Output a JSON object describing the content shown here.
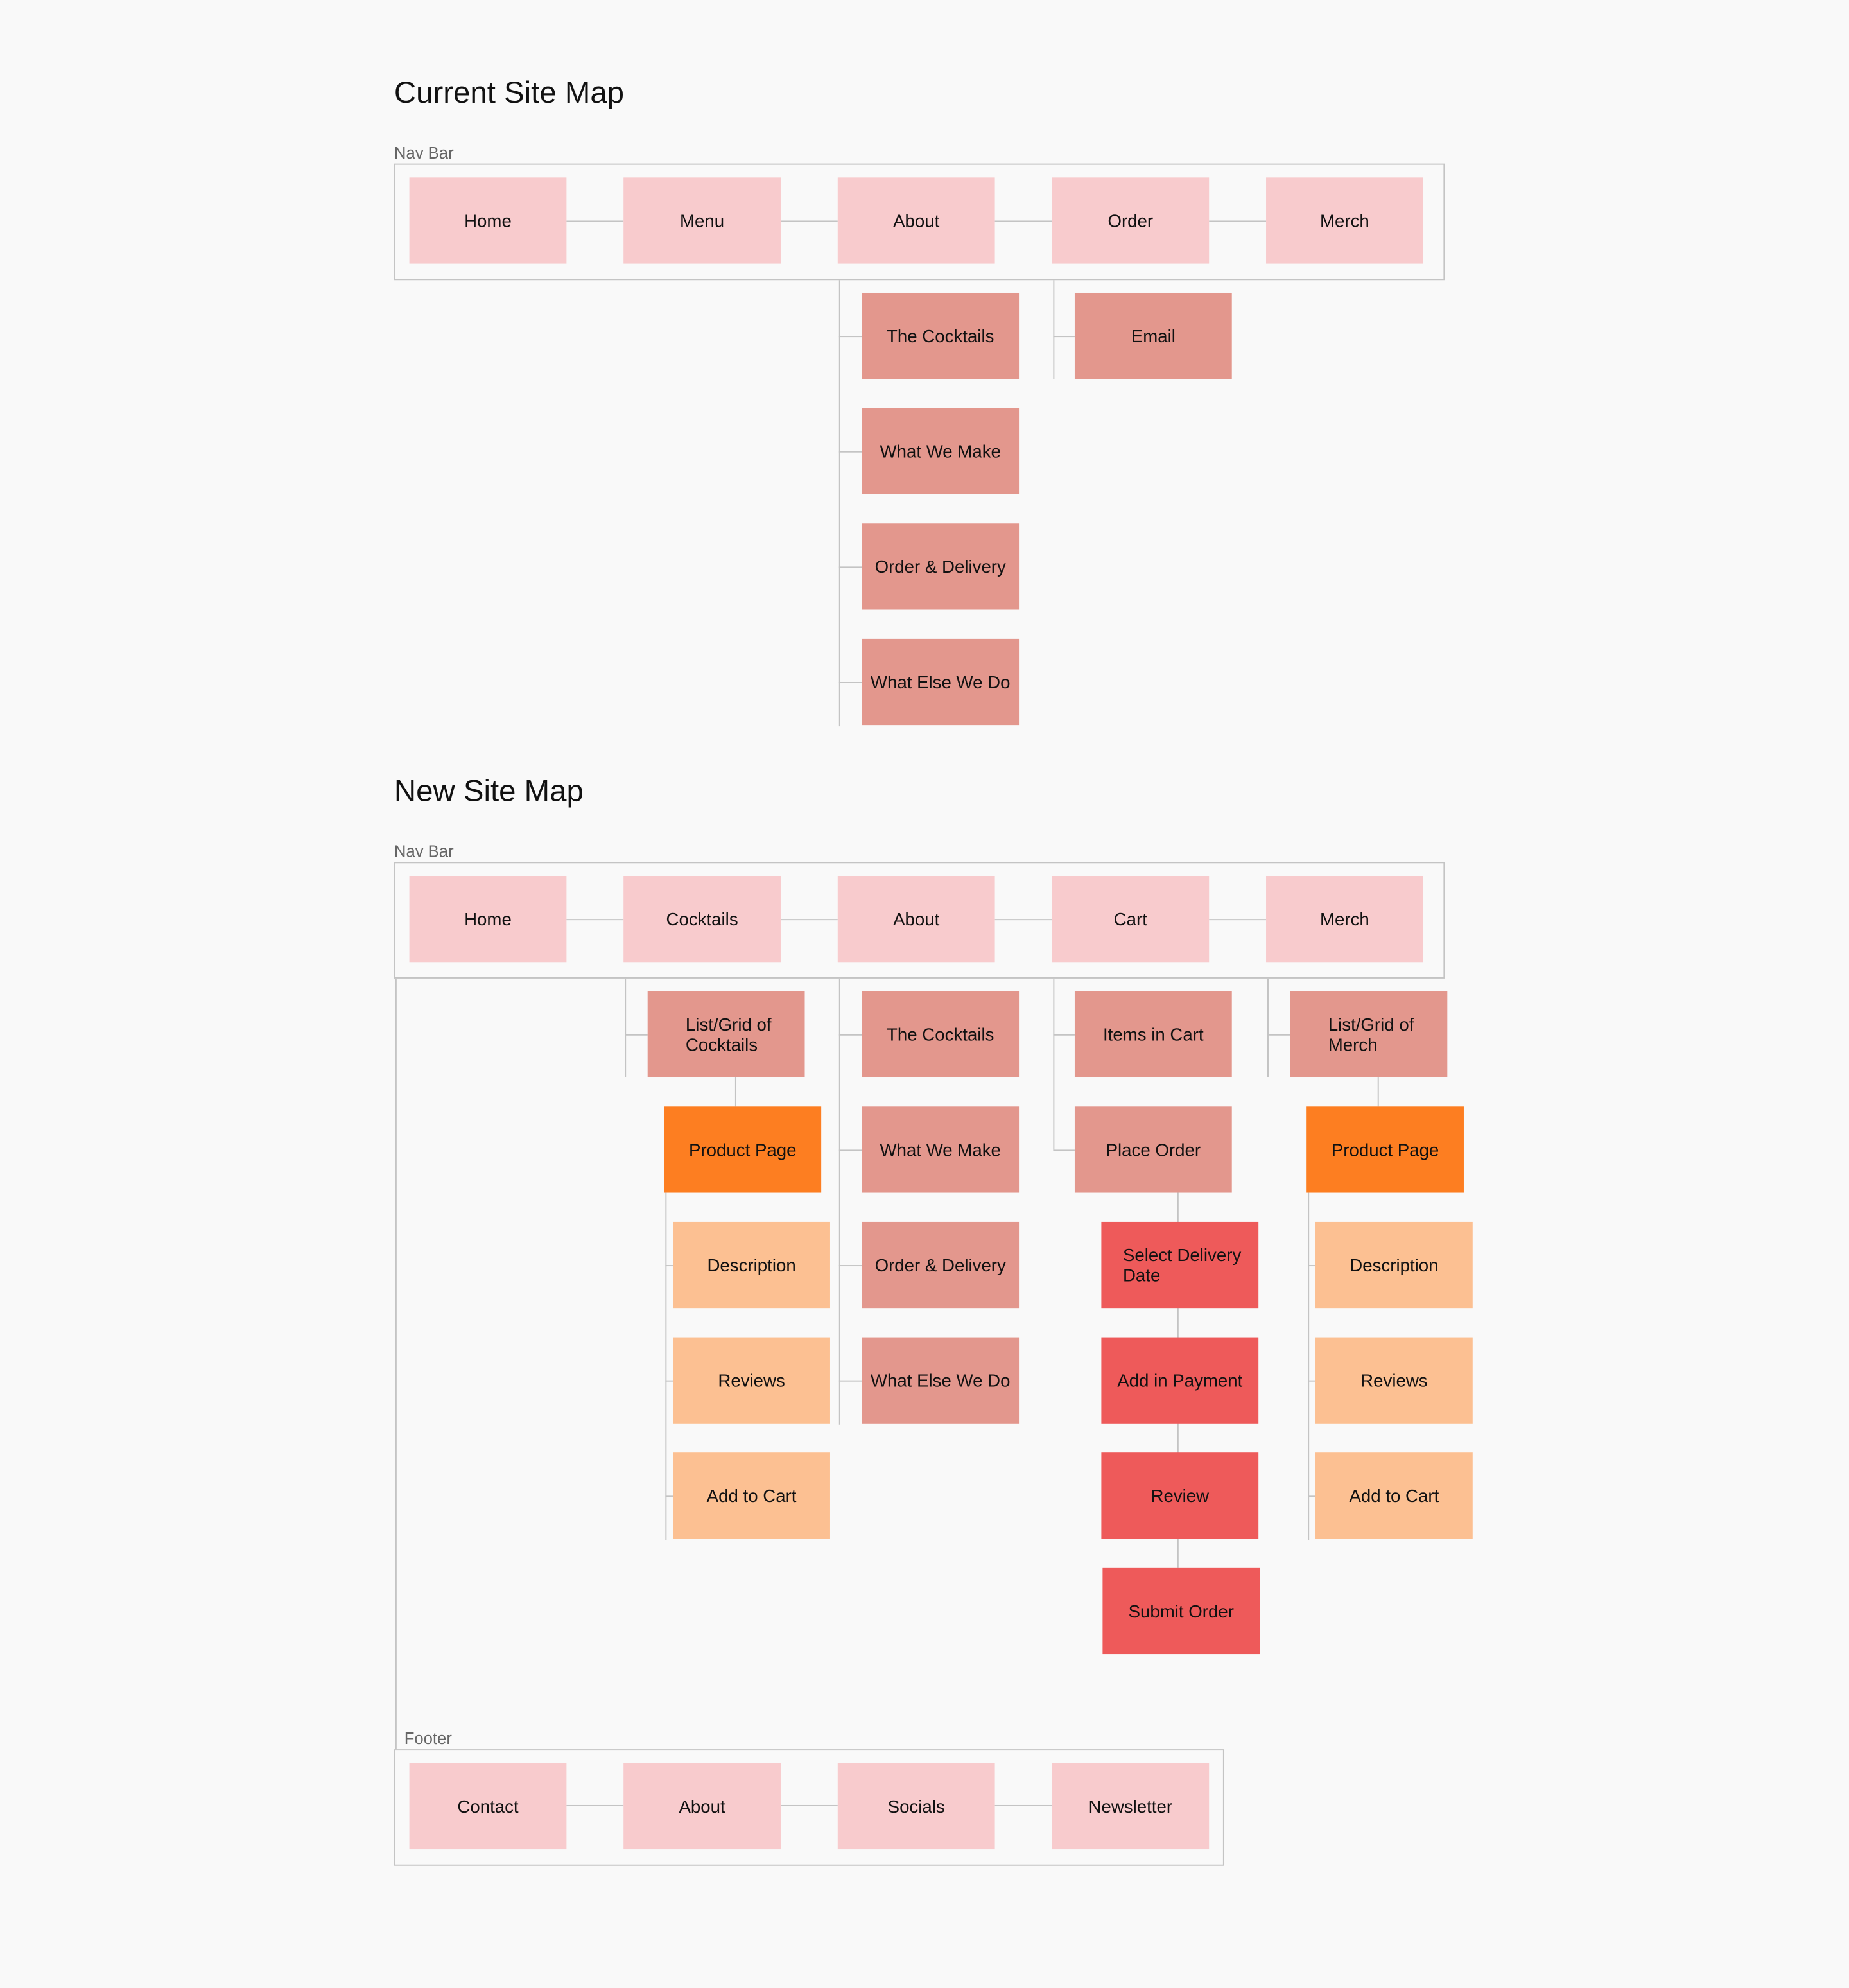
{
  "current": {
    "title": "Current Site Map",
    "nav_label": "Nav Bar",
    "nav": [
      "Home",
      "Menu",
      "About",
      "Order",
      "Merch"
    ],
    "about_children": [
      "The Cocktails",
      "What We Make",
      "Order & Delivery",
      "What Else We Do"
    ],
    "order_children": [
      "Email"
    ]
  },
  "new": {
    "title": "New Site Map",
    "nav_label": "Nav Bar",
    "nav": [
      "Home",
      "Cocktails",
      "About",
      "Cart",
      "Merch"
    ],
    "cocktails": {
      "list": "List/Grid of Cocktails",
      "product_page": "Product Page",
      "children": [
        "Description",
        "Reviews",
        "Add to Cart"
      ]
    },
    "about_children": [
      "The Cocktails",
      "What We Make",
      "Order & Delivery",
      "What Else We Do"
    ],
    "cart": {
      "children": [
        "Items in Cart",
        "Place Order"
      ],
      "steps": [
        "Select Delivery Date",
        "Add in Payment",
        "Review",
        "Submit Order"
      ]
    },
    "merch": {
      "list": "List/Grid of Merch",
      "product_page": "Product Page",
      "children": [
        "Description",
        "Reviews",
        "Add to Cart"
      ]
    },
    "footer_label": "Footer",
    "footer": [
      "Contact",
      "About",
      "Socials",
      "Newsletter"
    ]
  },
  "colors": {
    "level1": "#f8cbcd",
    "level2": "#e3978d",
    "product_page": "#fd7e21",
    "level3": "#fcc092",
    "checkout_step": "#ee5a5a",
    "connector": "#c4c4c4"
  }
}
